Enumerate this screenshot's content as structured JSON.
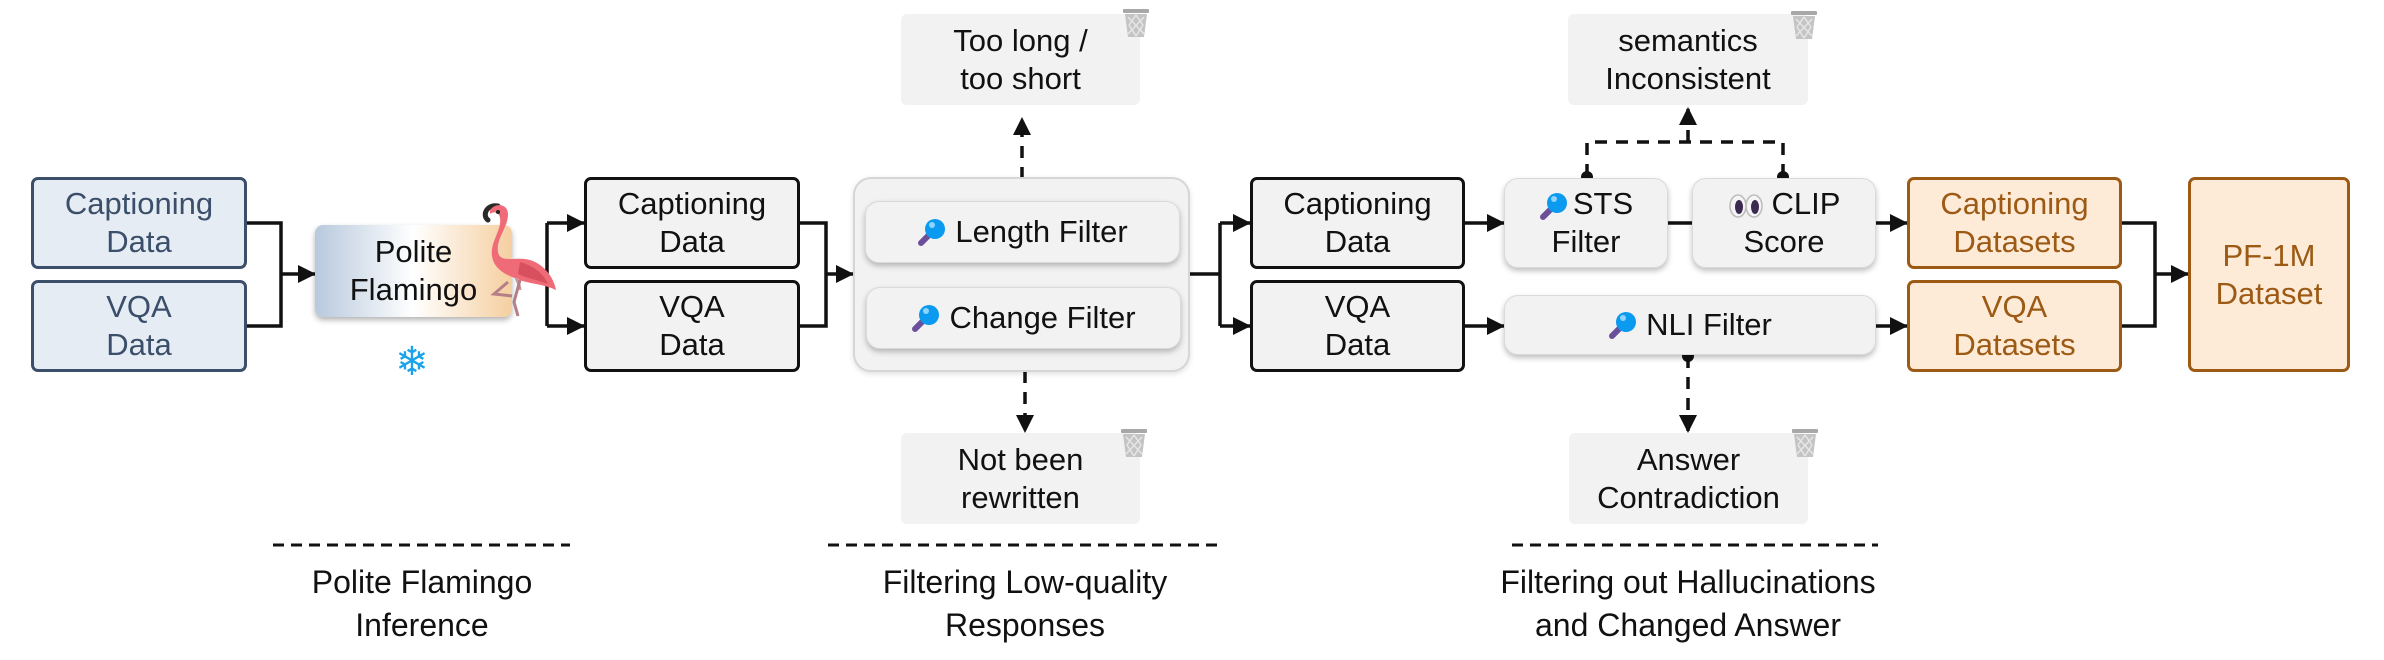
{
  "stage1": {
    "inputs": [
      {
        "line1": "Captioning",
        "line2": "Data"
      },
      {
        "line1": "VQA",
        "line2": "Data"
      }
    ],
    "model": {
      "line1": "Polite",
      "line2": "Flamingo",
      "icon": "flamingo-icon",
      "status_icon": "snowflake-icon",
      "status_glyph": "❄"
    },
    "outputs": [
      {
        "line1": "Captioning",
        "line2": "Data"
      },
      {
        "line1": "VQA",
        "line2": "Data"
      }
    ],
    "caption": {
      "line1": "Polite Flamingo",
      "line2": "Inference"
    }
  },
  "stage2": {
    "filters": [
      {
        "label": "Length Filter",
        "icon": "magnifier-icon"
      },
      {
        "label": "Change Filter",
        "icon": "magnifier-icon"
      }
    ],
    "rejects": [
      {
        "line1": "Too long /",
        "line2": "too short",
        "icon": "trash-icon"
      },
      {
        "line1": "Not been",
        "line2": "rewritten",
        "icon": "trash-icon"
      }
    ],
    "outputs": [
      {
        "line1": "Captioning",
        "line2": "Data"
      },
      {
        "line1": "VQA",
        "line2": "Data"
      }
    ],
    "caption": {
      "line1": "Filtering Low-quality",
      "line2": "Responses"
    }
  },
  "stage3": {
    "filters": [
      {
        "line1": "STS",
        "line2": "Filter",
        "icon": "magnifier-icon"
      },
      {
        "line1": "CLIP",
        "line2": "Score",
        "icon": "eyes-icon"
      },
      {
        "label": "NLI Filter",
        "icon": "magnifier-icon"
      }
    ],
    "rejects": [
      {
        "line1": "semantics",
        "line2": "Inconsistent",
        "icon": "trash-icon"
      },
      {
        "line1": "Answer",
        "line2": "Contradiction",
        "icon": "trash-icon"
      }
    ],
    "outputs": [
      {
        "line1": "Captioning",
        "line2": "Datasets"
      },
      {
        "line1": "VQA",
        "line2": "Datasets"
      }
    ],
    "caption": {
      "line1": "Filtering out Hallucinations",
      "line2": "and Changed Answer"
    }
  },
  "final": {
    "line1": "PF-1M",
    "line2": "Dataset"
  },
  "colors": {
    "input_fill": "#e6ecf4",
    "input_border": "#3b4f6b",
    "output_fill": "#fdebd7",
    "output_border": "#9c5a14",
    "neutral_fill": "#f2f2f2",
    "line": "#111111",
    "snowflake": "#1aa3e8"
  }
}
